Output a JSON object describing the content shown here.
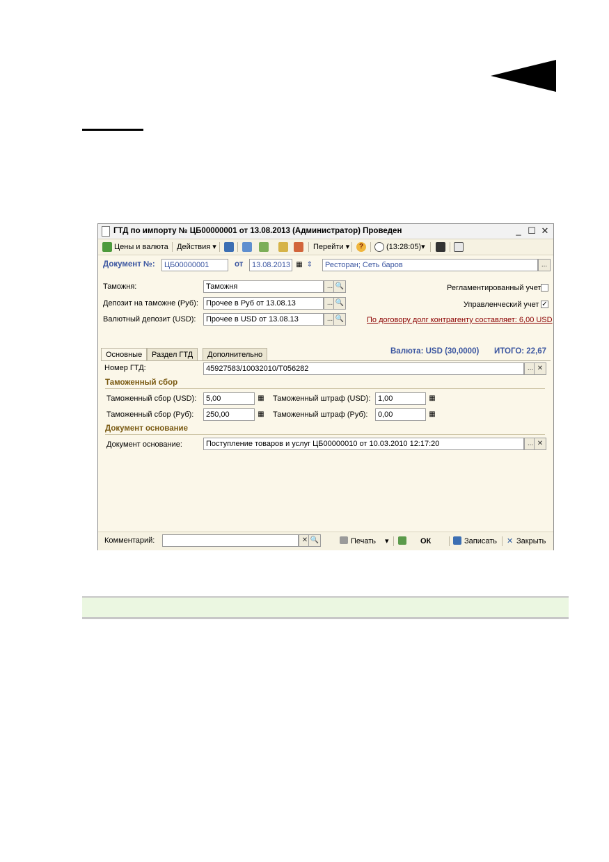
{
  "window": {
    "title": "ГТД по импорту № ЦБ00000001 от 13.08.2013 (Администратор) Проведен",
    "minimize_glyph": "_",
    "maximize_glyph": "☐",
    "close_glyph": "✕"
  },
  "toolbar": {
    "prices_label": "Цены и валюта",
    "actions_label": "Действия",
    "goto_label": "Перейти",
    "help_glyph": "?",
    "time_label": "(13:28:05)",
    "dropdown_glyph": "▾"
  },
  "document": {
    "number_label": "Документ №:",
    "number_value": "ЦБ00000001",
    "date_label": "от",
    "date_value": "13.08.2013",
    "org_value": "Ресторан; Сеть баров"
  },
  "header_fields": {
    "customs_label": "Таможня:",
    "customs_value": "Таможня",
    "deposit_rub_label": "Депозит на таможне (Руб):",
    "deposit_rub_value": "Прочее в Руб от 13.08.13",
    "deposit_usd_label": "Валютный депозит (USD):",
    "deposit_usd_value": "Прочее в USD от 13.08.13",
    "regulated_label": "Регламентированный учет",
    "regulated_checked": "",
    "management_label": "Управленческий учет",
    "management_checked": "✓",
    "debt_link": "По договору долг контрагенту составляет: 6,00 USD",
    "currency_label": "Валюта: USD (30,0000)",
    "total_label": "ИТОГО: 22,67"
  },
  "tabs": [
    {
      "label": "Основные"
    },
    {
      "label": "Раздел ГТД"
    },
    {
      "label": "Дополнительно"
    }
  ],
  "main": {
    "gtd_number_label": "Номер ГТД:",
    "gtd_number_value": "45927583/10032010/Т056282",
    "customs_fee_section": "Таможенный сбор",
    "fee_usd_label": "Таможенный сбор (USD):",
    "fee_usd_value": "5,00",
    "fine_usd_label": "Таможенный штраф (USD):",
    "fine_usd_value": "1,00",
    "fee_rub_label": "Таможенный сбор (Руб):",
    "fee_rub_value": "250,00",
    "fine_rub_label": "Таможенный штраф (Руб):",
    "fine_rub_value": "0,00",
    "basis_section": "Документ основание",
    "basis_label": "Документ основание:",
    "basis_value": "Поступление товаров и услуг ЦБ00000010 от 10.03.2010 12:17:20"
  },
  "bottom": {
    "comment_label": "Комментарий:",
    "comment_value": "",
    "print_label": "Печать",
    "ok_label": "ОК",
    "save_label": "Записать",
    "close_label": "Закрыть"
  },
  "glyphs": {
    "ellipsis": "...",
    "clear": "✕",
    "search": "🔍",
    "calc": "▦",
    "spin": "⇕"
  }
}
